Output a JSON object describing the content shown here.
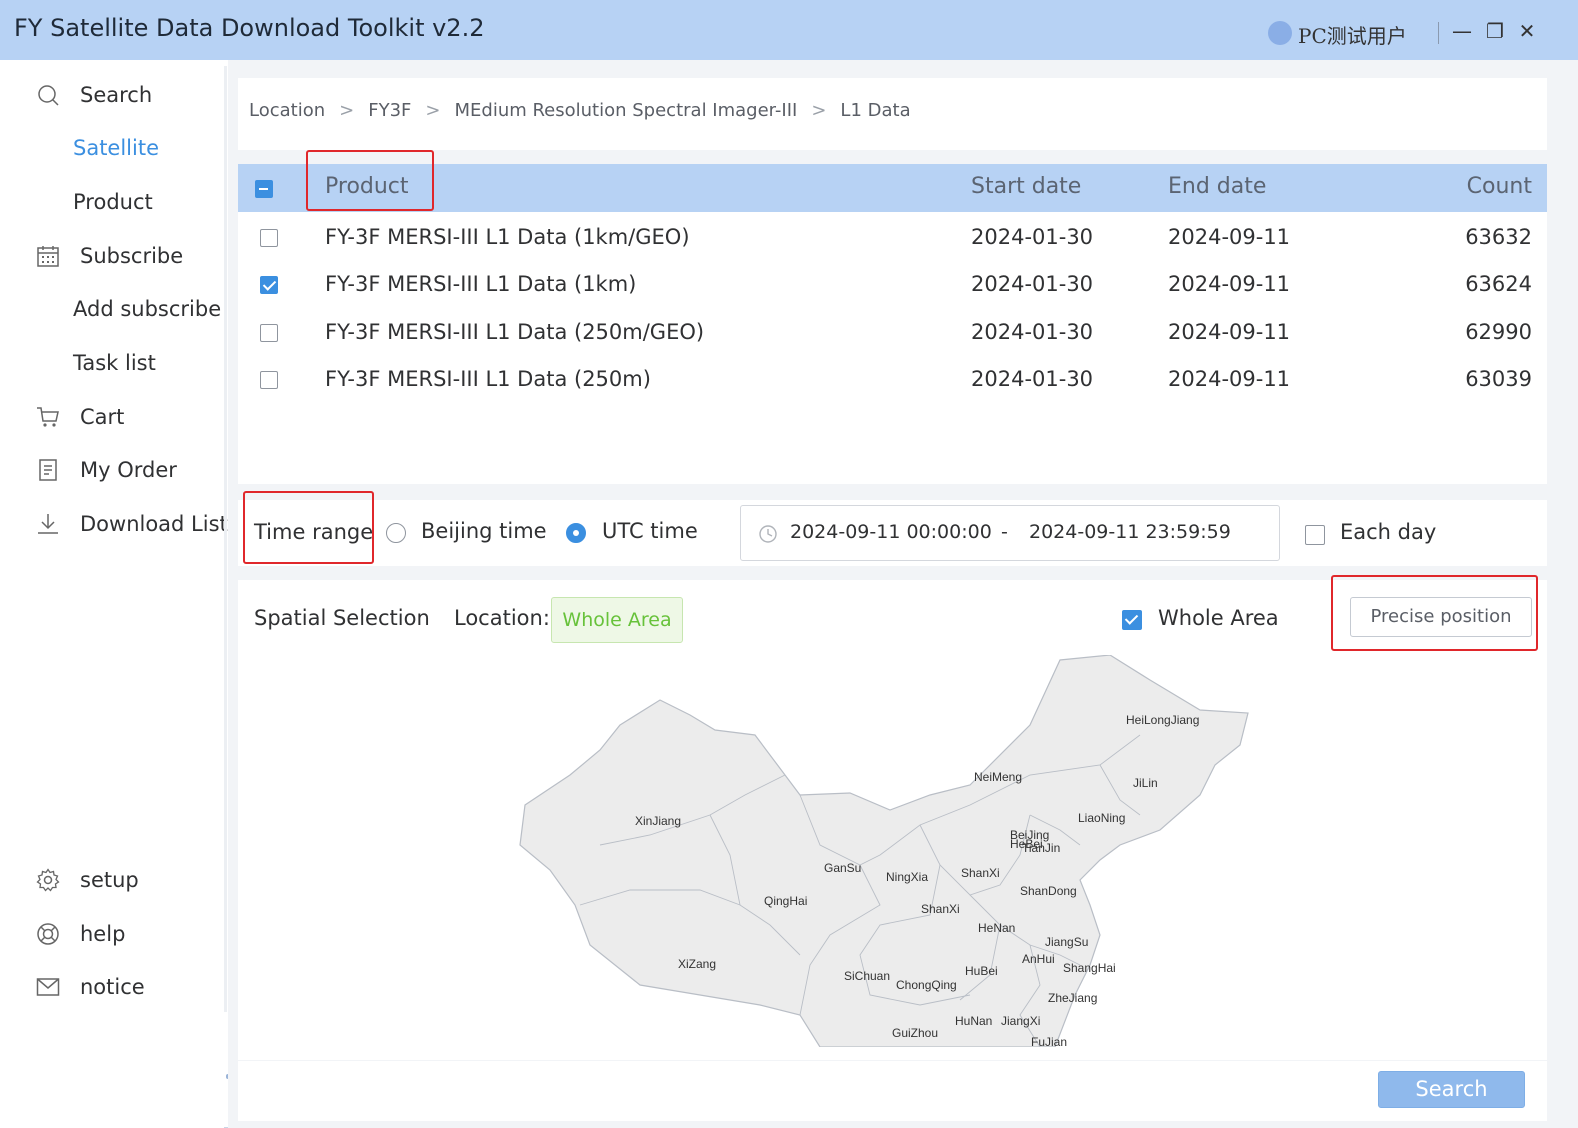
{
  "window": {
    "title": "FY Satellite Data Download Toolkit v2.2",
    "user_name": "PC测试用户",
    "minimize_glyph": "—",
    "maximize_glyph": "❐",
    "close_glyph": "✕"
  },
  "sidebar": {
    "search": "Search",
    "satellite": "Satellite",
    "product": "Product",
    "subscribe": "Subscribe",
    "add_subscribe": "Add subscribe",
    "task_list": "Task list",
    "cart": "Cart",
    "my_order": "My Order",
    "download_list": "Download List",
    "setup": "setup",
    "help": "help",
    "notice": "notice"
  },
  "breadcrumb": {
    "items": [
      "Location",
      "FY3F",
      "MEdium Resolution Spectral Imager-III",
      "L1 Data"
    ],
    "separator": ">"
  },
  "table": {
    "headers": {
      "product": "Product",
      "start_date": "Start date",
      "end_date": "End date",
      "count": "Count"
    },
    "rows": [
      {
        "product": "FY-3F MERSI-III L1 Data (1km/GEO)",
        "start_date": "2024-01-30",
        "end_date": "2024-09-11",
        "count": "63632",
        "checked": false
      },
      {
        "product": "FY-3F MERSI-III L1 Data (1km)",
        "start_date": "2024-01-30",
        "end_date": "2024-09-11",
        "count": "63624",
        "checked": true
      },
      {
        "product": "FY-3F MERSI-III L1 Data (250m/GEO)",
        "start_date": "2024-01-30",
        "end_date": "2024-09-11",
        "count": "62990",
        "checked": false
      },
      {
        "product": "FY-3F MERSI-III L1 Data (250m)",
        "start_date": "2024-01-30",
        "end_date": "2024-09-11",
        "count": "63039",
        "checked": false
      }
    ]
  },
  "time_range": {
    "label": "Time range",
    "beijing_time": "Beijing time",
    "utc_time": "UTC time",
    "selected": "UTC time",
    "start": "2024-09-11 00:00:00",
    "separator": "-",
    "end": "2024-09-11 23:59:59",
    "each_day": "Each day",
    "each_day_checked": false
  },
  "spatial": {
    "label": "Spatial Selection",
    "location_label": "Location:",
    "location_value": "Whole Area",
    "whole_area_label": "Whole Area",
    "whole_area_checked": true,
    "precise_button": "Precise position"
  },
  "map": {
    "provinces": [
      "HeiLongJiang",
      "JiLin",
      "NeiMeng",
      "LiaoNing",
      "XinJiang",
      "BeiJing",
      "HeBei",
      "TianJin",
      "GanSu",
      "NingXia",
      "ShanXi",
      "ShanDong",
      "QingHai",
      "ShanXi",
      "HeNan",
      "JiangSu",
      "AnHui",
      "ShangHai",
      "XiZang",
      "SiChuan",
      "HuBei",
      "ChongQing",
      "ZheJiang",
      "HuNan",
      "JiangXi",
      "GuiZhou",
      "FuJian"
    ]
  },
  "footer": {
    "search_button": "Search"
  },
  "colors": {
    "accent": "#3b8fe0",
    "header_bg": "#b7d2f4",
    "highlight": "#e0272b",
    "green_tag": "#67c23a"
  }
}
